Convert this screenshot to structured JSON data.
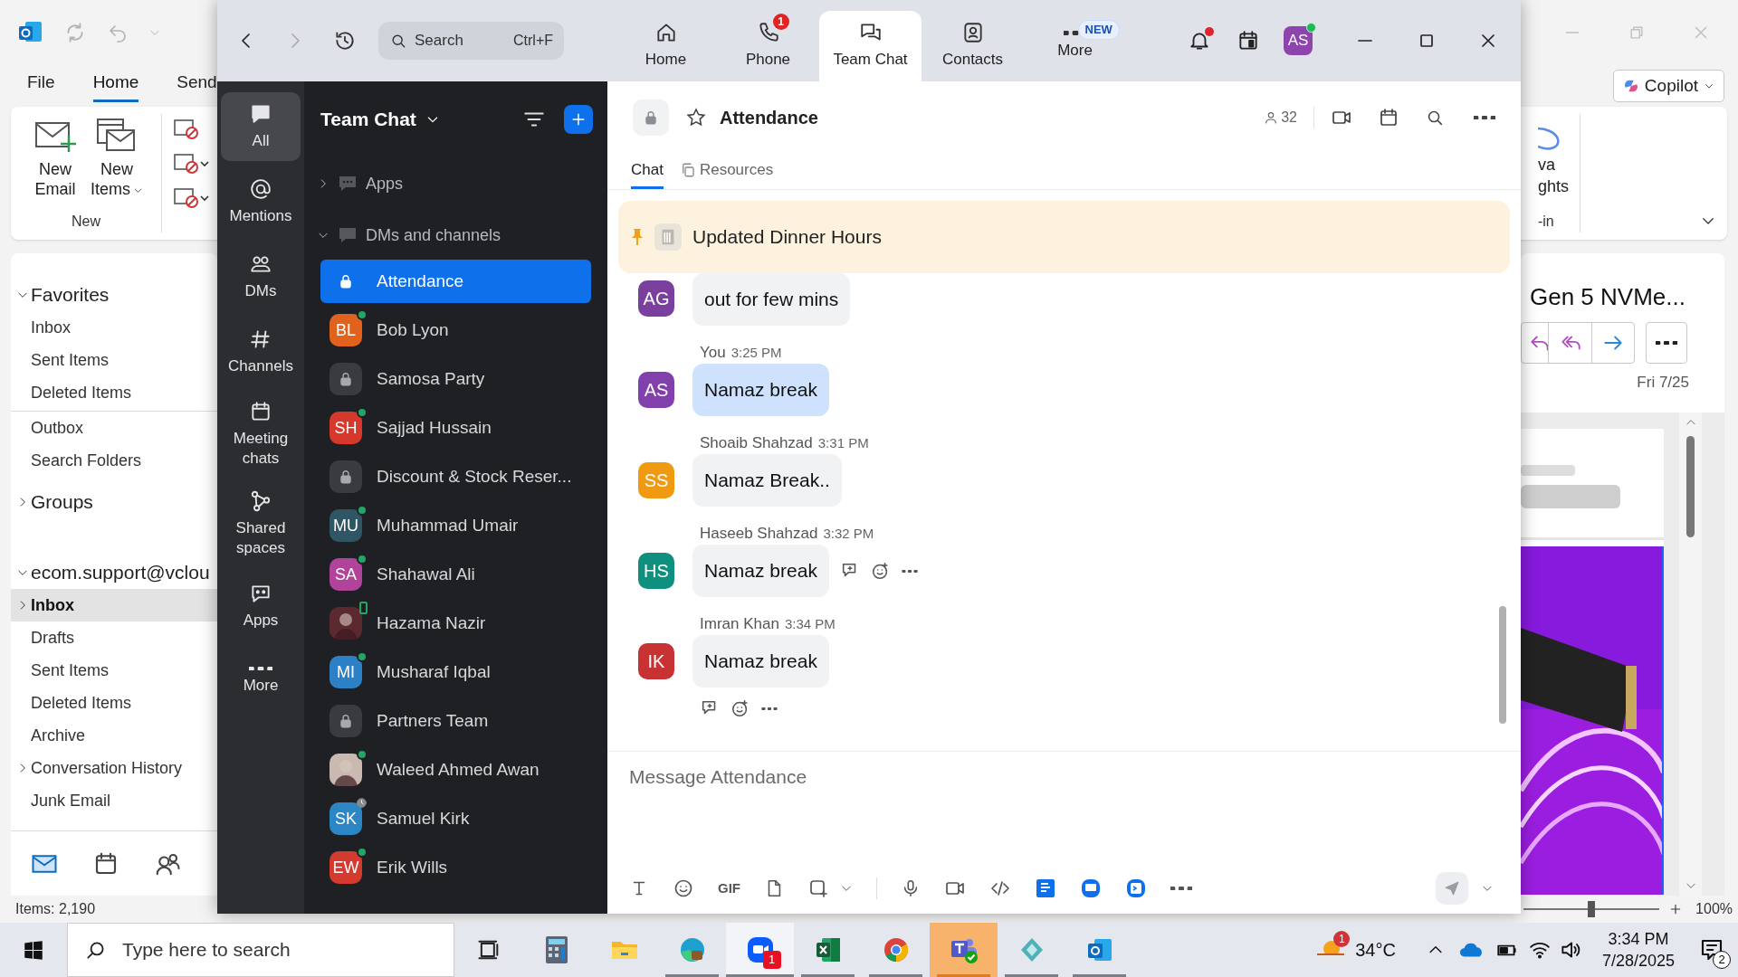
{
  "outlook": {
    "menu": [
      {
        "label": "File",
        "selected": false
      },
      {
        "label": "Home",
        "selected": true
      },
      {
        "label": "Send",
        "selected": false
      }
    ],
    "ribbon": {
      "buttons": [
        {
          "label": "New Email",
          "kind": "new-email",
          "caret": false
        },
        {
          "label": "New Items",
          "kind": "new-items",
          "caret": true
        }
      ],
      "group": "New",
      "right_label": [
        "va",
        "ghts"
      ],
      "right_group": "-in"
    },
    "copilot": "Copilot",
    "folders": [
      {
        "label": "Favorites",
        "expanded": true,
        "children": [
          {
            "label": "Inbox",
            "selected": false
          },
          {
            "label": "Sent Items",
            "selected": false
          },
          {
            "label": "Deleted Items",
            "selected": false
          }
        ]
      },
      {
        "children": [
          {
            "label": "Outbox",
            "selected": false
          },
          {
            "label": "Search Folders",
            "selected": false
          }
        ]
      },
      {
        "label": "Groups",
        "expanded": false
      },
      {
        "label": "ecom.support@vclou",
        "expanded": true,
        "children": [
          {
            "label": "Inbox",
            "selected": true,
            "expanded": false
          },
          {
            "label": "Drafts",
            "selected": false
          },
          {
            "label": "Sent Items",
            "selected": false
          },
          {
            "label": "Deleted Items",
            "selected": false
          },
          {
            "label": "Archive",
            "selected": false
          },
          {
            "label": "Conversation History",
            "selected": false,
            "expanded": false
          },
          {
            "label": "Junk Email",
            "selected": false
          }
        ]
      }
    ],
    "status": "Items: 2,190",
    "reading_pane": {
      "subject": "Gen 5 NVMe...",
      "date": "Fri 7/25",
      "zoom": "100%",
      "zoom_slider": {
        "level": 0.5
      }
    }
  },
  "zoom": {
    "search": {
      "placeholder": "Search",
      "shortcut": "Ctrl+F"
    },
    "tabs": [
      {
        "label": "Home",
        "kind": "home",
        "selected": false
      },
      {
        "label": "Phone",
        "kind": "phone",
        "badge": "1",
        "selected": false
      },
      {
        "label": "Team Chat",
        "kind": "chat",
        "selected": true
      },
      {
        "label": "Contacts",
        "kind": "contacts",
        "selected": false
      },
      {
        "label": "More",
        "kind": "more",
        "tag": "NEW",
        "selected": false
      }
    ],
    "unread_notifications": true,
    "avatar": {
      "initials": "AS",
      "color": "#8e44ad",
      "online": true
    },
    "rail": [
      {
        "label": "All",
        "kind": "all",
        "selected": true
      },
      {
        "label": "Mentions",
        "kind": "mentions",
        "selected": false
      },
      {
        "label": "DMs",
        "kind": "dms",
        "selected": false
      },
      {
        "label": "Channels",
        "kind": "channels",
        "selected": false
      },
      {
        "label": "Meeting chats",
        "kind": "meetings",
        "selected": false
      },
      {
        "label": "Shared spaces",
        "kind": "shared",
        "selected": false
      },
      {
        "label": "Apps",
        "kind": "apps",
        "selected": false
      },
      {
        "label": "More",
        "kind": "more",
        "selected": false
      }
    ],
    "list": {
      "title": "Team Chat",
      "sections": [
        {
          "label": "Apps",
          "kind": "apps",
          "expanded": false
        },
        {
          "label": "DMs and channels",
          "kind": "dms",
          "expanded": true
        }
      ],
      "items": [
        {
          "kind": "channel",
          "name": "Attendance",
          "selected": true
        },
        {
          "kind": "person",
          "name": "Bob Lyon",
          "initials": "BL",
          "color": "#e0621c",
          "online": true,
          "selected": false
        },
        {
          "kind": "channel",
          "name": "Samosa Party",
          "selected": false
        },
        {
          "kind": "person",
          "name": "Sajjad Hussain",
          "initials": "SH",
          "color": "#d7382c",
          "online": true,
          "selected": false
        },
        {
          "kind": "channel",
          "name": "Discount & Stock Reser...",
          "selected": false
        },
        {
          "kind": "person",
          "name": "Muhammad Umair",
          "initials": "MU",
          "color": "#2f5664",
          "online": true,
          "selected": false
        },
        {
          "kind": "person",
          "name": "Shahawal Ali",
          "initials": "SA",
          "color": "#b2439a",
          "online": true,
          "selected": false
        },
        {
          "name": "Hazama Nazir",
          "color": "#5b2a30",
          "online": false,
          "mobile": true,
          "selected": false
        },
        {
          "kind": "person",
          "name": "Musharaf Iqbal",
          "initials": "MI",
          "color": "#2b80c6",
          "online": true,
          "selected": false
        },
        {
          "kind": "channel",
          "name": "Partners Team",
          "selected": false
        },
        {
          "name": "Waleed Ahmed Awan",
          "color": "#c9b9b0",
          "online": true,
          "selected": false
        },
        {
          "kind": "person",
          "name": "Samuel Kirk",
          "initials": "SK",
          "color": "#2b86c5",
          "online": false,
          "away": true,
          "selected": false
        },
        {
          "kind": "person",
          "name": "Erik Wills",
          "initials": "EW",
          "color": "#d43a2e",
          "online": true,
          "selected": false
        }
      ]
    },
    "chat": {
      "title": "Attendance",
      "members": "32",
      "starred": false,
      "tabs": [
        {
          "label": "Chat",
          "kind": "chat",
          "selected": true
        },
        {
          "label": "Resources",
          "kind": "resources",
          "selected": false
        }
      ],
      "pinned": "Updated Dinner Hours",
      "messages": [
        {
          "initials": "AG",
          "color": "#7b3f9e",
          "text": "out for few mins",
          "mine": false
        },
        {
          "initials": "AS",
          "color": "#8140ab",
          "sender": "You",
          "time": "3:25 PM",
          "text": "Namaz break",
          "mine": true
        },
        {
          "initials": "SS",
          "color": "#f09a12",
          "sender": "Shoaib Shahzad",
          "time": "3:31 PM",
          "text": "Namaz Break..",
          "mine": false
        },
        {
          "initials": "HS",
          "color": "#0f907f",
          "sender": "Haseeb Shahzad",
          "time": "3:32 PM",
          "text": "Namaz break",
          "mine": false,
          "hovered": true
        },
        {
          "initials": "IK",
          "color": "#c93232",
          "sender": "Imran Khan",
          "time": "3:34 PM",
          "text": "Namaz break",
          "mine": false,
          "action_row": true
        }
      ],
      "composer": {
        "placeholder": "Message Attendance",
        "gif": "GIF"
      }
    }
  },
  "taskbar": {
    "search_placeholder": "Type here to search",
    "apps": [
      {
        "kind": "task-view",
        "running": false,
        "active": false,
        "flashing": false
      },
      {
        "kind": "calculator",
        "running": false,
        "active": false,
        "flashing": false
      },
      {
        "kind": "file-explorer",
        "running": false,
        "active": false,
        "flashing": false
      },
      {
        "kind": "edge",
        "running": true,
        "active": false,
        "flashing": false
      },
      {
        "kind": "zoom",
        "running": true,
        "active": true,
        "flashing": false,
        "badge": "1"
      },
      {
        "kind": "excel",
        "running": true,
        "active": false,
        "flashing": false
      },
      {
        "kind": "chrome",
        "running": true,
        "active": false,
        "flashing": false
      },
      {
        "kind": "teams",
        "running": true,
        "active": false,
        "flashing": true
      },
      {
        "kind": "app",
        "running": true,
        "active": false,
        "flashing": false
      },
      {
        "kind": "outlook",
        "running": true,
        "active": false,
        "flashing": false
      }
    ],
    "weather": {
      "badge": "1",
      "temperature": "34°C"
    },
    "time": "3:34 PM",
    "date": "7/28/2025",
    "notifications": "2"
  }
}
